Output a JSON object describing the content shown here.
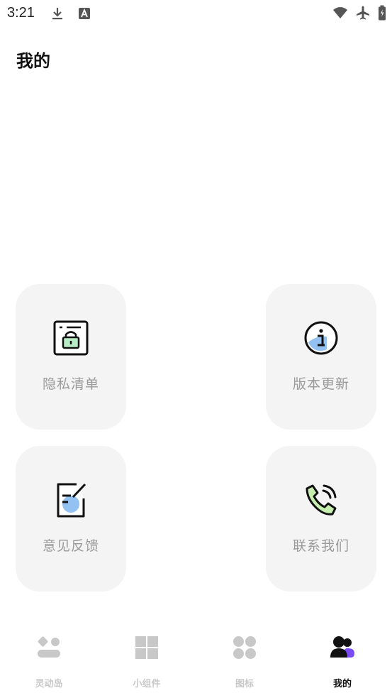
{
  "status_bar": {
    "time": "3:21",
    "icons": [
      "download-icon",
      "a-letter-icon",
      "wifi-icon",
      "airplane-icon",
      "battery-icon"
    ]
  },
  "page": {
    "title": "我的"
  },
  "cards": [
    {
      "label": "隐私清单",
      "icon": "privacy-lock-icon"
    },
    {
      "label": "版本更新",
      "icon": "info-icon"
    },
    {
      "label": "意见反馈",
      "icon": "feedback-edit-icon"
    },
    {
      "label": "联系我们",
      "icon": "phone-call-icon"
    }
  ],
  "bottom_nav": {
    "items": [
      {
        "label": "灵动岛",
        "icon": "dynamic-island-icon",
        "active": false
      },
      {
        "label": "小组件",
        "icon": "widgets-icon",
        "active": false
      },
      {
        "label": "图标",
        "icon": "icons-grid-icon",
        "active": false
      },
      {
        "label": "我的",
        "icon": "profile-users-icon",
        "active": true
      }
    ]
  },
  "colors": {
    "card_bg": "#f4f4f4",
    "label_gray": "#9a9a9a",
    "nav_inactive": "#c8c8c8",
    "accent_green": "#b8ecc4",
    "accent_blue": "#7fb6f0",
    "accent_purple": "#7b4cf6"
  }
}
